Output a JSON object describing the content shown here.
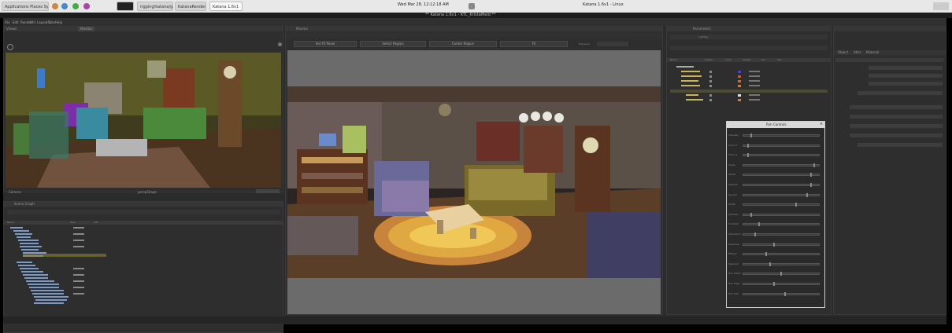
{
  "os": {
    "app_menu": "Applications",
    "places_menu": "Places",
    "system_menu": "System",
    "clock": "Wed Mar 28, 12:12:18 AM",
    "window_title": "Katana 1.6v1 - KTC_Kristalfield",
    "right_title": "Katana 1.6v1 - Linux",
    "tabs": [
      "Applications  Places  System",
      "",
      "",
      "",
      "",
      "rigging/katana/gpu",
      "KatanaRender",
      "Katana 1.6v1"
    ]
  },
  "app": {
    "title": "** Katana 1.6v1 - KTC_Kristalfield **",
    "menus": [
      "File",
      "Edit",
      "Render",
      "Util",
      "Layouts",
      "Tabs",
      "Help"
    ]
  },
  "viewer": {
    "tabs": [
      "Viewer",
      "Monitor"
    ],
    "camera_label": "persp",
    "footer_left": "Camera",
    "footer_center": "perspShape"
  },
  "scenegraph": {
    "header": "Scene Graph",
    "columns": [
      "Name",
      "Type",
      "Info"
    ]
  },
  "monitor": {
    "tab": "Monitor",
    "buttons": [
      "Set Fit Panel",
      "Select Region",
      "Center Region",
      "Fit",
      "Exposure"
    ]
  },
  "params": {
    "tab": "Parameters",
    "node_name": "LightRig",
    "columns": [
      "Name",
      "Visible",
      "Color",
      "Shader",
      "Int",
      "Exp"
    ]
  },
  "rim_controls": {
    "title": "Rim Controls",
    "labels": [
      "Intensity",
      "Color R",
      "Color G",
      "Angle",
      "Falloff",
      "Shadow",
      "Spread",
      "Width",
      "Softness",
      "Contrast",
      "Saturation",
      "Exposure",
      "Diffuse",
      "Specular",
      "Rim Width",
      "Rim Edge",
      "Rim Soft"
    ]
  },
  "attrs": {
    "tabs": [
      "Object",
      "Attrs",
      "Material"
    ]
  },
  "colors": {
    "accent_yellow": "#c8b45a",
    "panel": "#2e2e2e",
    "viewport_grey": "#6b6b6b"
  }
}
